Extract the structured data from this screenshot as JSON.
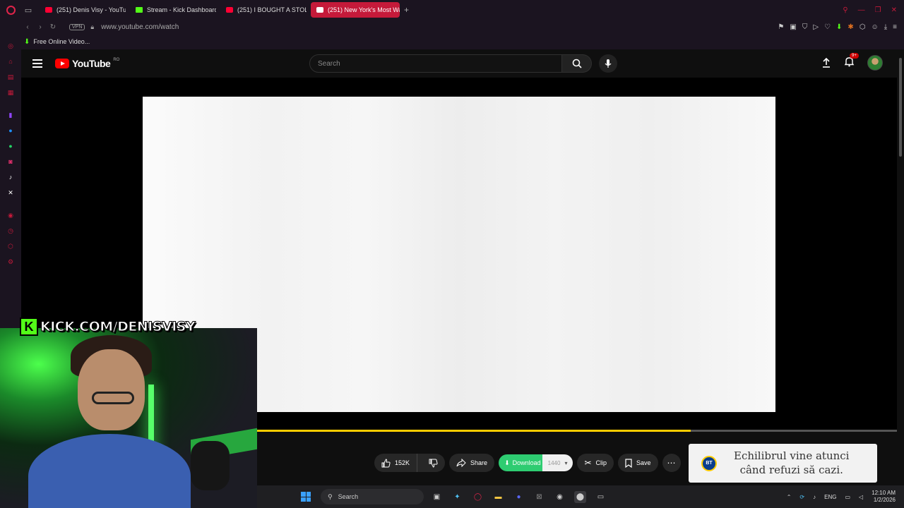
{
  "browser": {
    "tabs": [
      {
        "label": "(251) Denis Visy - YouTube",
        "favicon": "youtube-icon",
        "active": false
      },
      {
        "label": "Stream - Kick Dashboard",
        "favicon": "kick-icon",
        "active": false
      },
      {
        "label": "(251) I BOUGHT A STOLE",
        "favicon": "youtube-icon",
        "active": false
      },
      {
        "label": "(251) New York's Most Wa",
        "favicon": "youtube-icon",
        "active": true
      }
    ],
    "vpn_label": "VPN",
    "url": "www.youtube.com/watch",
    "bookmark": "Free Online Video..."
  },
  "youtube": {
    "logo_word": "YouTube",
    "country_code": "RO",
    "search_placeholder": "Search",
    "notifications_badge": "9+",
    "progress_fraction": 0.678
  },
  "actions": {
    "like_count": "152K",
    "share_label": "Share",
    "download_label": "Download",
    "download_quality": "1440",
    "clip_label": "Clip",
    "save_label": "Save"
  },
  "ad": {
    "logo_text": "BT",
    "line1": "Echilibrul vine atunci",
    "line2": "când refuzi să cazi."
  },
  "overlay": {
    "kick_letter": "K",
    "kick_url": "KICK.COM/DENISVISY"
  },
  "taskbar": {
    "search_label": "Search",
    "language": "ENG",
    "time": "12:10 AM",
    "date": "1/2/2026"
  },
  "colors": {
    "opera_red": "#c51a3a",
    "youtube_red": "#ff0000",
    "kick_green": "#53fc18",
    "download_green": "#2ecc71",
    "progress_yellow": "#ffcc00"
  }
}
